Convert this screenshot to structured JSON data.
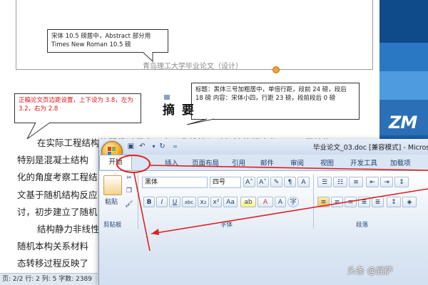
{
  "document": {
    "header_text": "青岛理工大学毕业论文（设计）",
    "abstract_heading": "摘 要",
    "callout_top": "宋体 10.5 磅居中，Abstract 部分用 Times New Roman 10.5 磅",
    "callout_left": "正稿论文页边距设置，上下设为 3.8，左为 3.2，右为 2.8",
    "callout_right": "标题：黑体三号加粗居中，单倍行距，段前 24 磅，段后 18 磅  内容：宋体小四，行距 23 磅，段前段后 0 磅",
    "body_lines": [
      "在实际工程结构的服役过程中，由于非线性与随机性的耦合作用，工程结构",
      "特别是混凝土结构",
      "化的角度考察工程结",
      "文基于随机结构反应",
      "讨，初步建立了随机",
      "结构静力非线性",
      "随机本构关系材料",
      "态转移过程反映了"
    ]
  },
  "status_bar": {
    "text": "页: 2/2  行: 2  列: 5  字数: 2389"
  },
  "word_window": {
    "title": "毕业论文_03.doc [兼容模式] - Microsoft Word",
    "tabs": [
      "开始",
      "插入",
      "页面布局",
      "引用",
      "邮件",
      "审阅",
      "视图",
      "开发工具",
      "加载项"
    ],
    "clipboard": {
      "paste_label": "粘贴",
      "group_label": "剪贴板"
    },
    "font": {
      "font_name": "黑体",
      "font_size": "四号",
      "group_label": "字体"
    },
    "paragraph": {
      "group_label": "段落"
    }
  },
  "watermark": "头条 @屁萨",
  "desktop_text": "ZM",
  "colors": {
    "ribbon_blue": "#dbe6f4",
    "annotation_red": "#e02020",
    "desktop_blue": "#1b5fa6"
  },
  "icons": [
    "office-button-icon",
    "save-icon",
    "undo-icon",
    "redo-icon",
    "paste-icon",
    "cut-icon",
    "copy-icon",
    "format-painter-icon",
    "bold-icon",
    "italic-icon",
    "underline-icon",
    "strikethrough-icon",
    "subscript-icon",
    "superscript-icon",
    "change-case-icon",
    "highlight-icon",
    "font-color-icon",
    "clear-format-icon",
    "bullets-icon",
    "numbering-icon",
    "multilevel-list-icon",
    "decrease-indent-icon",
    "increase-indent-icon",
    "sort-icon",
    "align-left-icon",
    "center-icon",
    "align-right-icon",
    "justify-icon",
    "line-spacing-icon",
    "shading-icon"
  ]
}
